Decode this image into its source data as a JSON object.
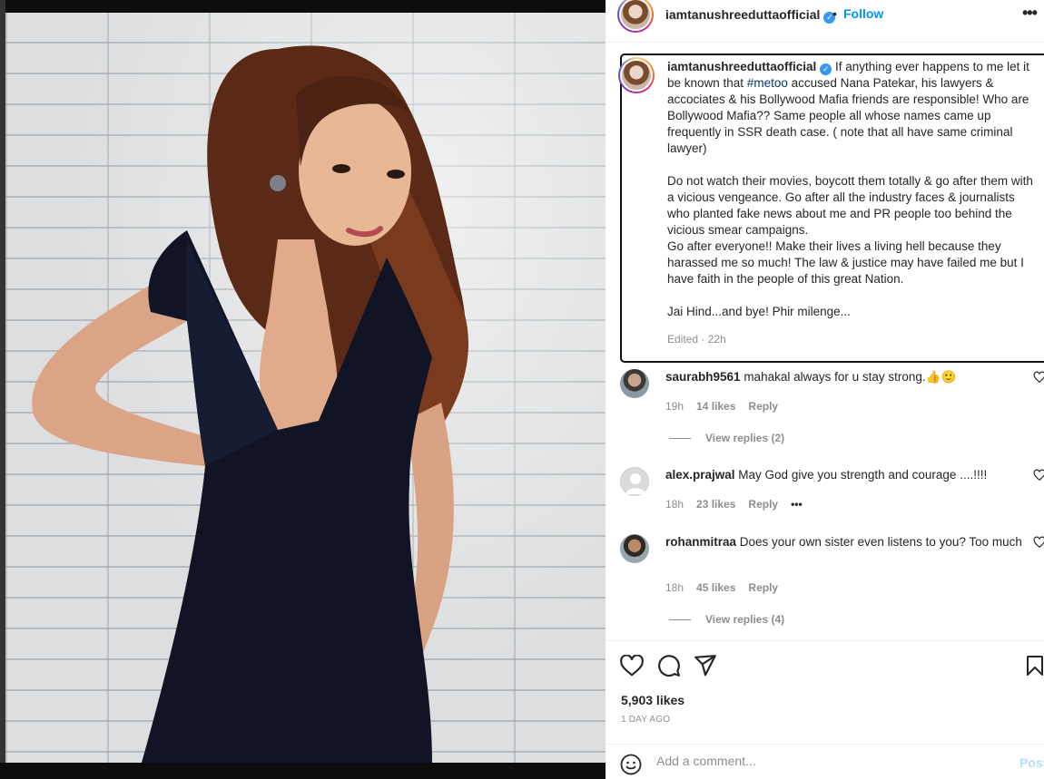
{
  "post": {
    "username": "iamtanushreeduttaofficial",
    "follow_label": "Follow",
    "dot": "•",
    "more_label": "•••"
  },
  "caption": {
    "username": "iamtanushreeduttaofficial",
    "text_before_tag": " If anything ever happens to me let it be known that ",
    "hashtag": "#metoo",
    "text_after_tag": " accused Nana Patekar, his lawyers & accociates & his Bollywood Mafia friends are responsible! Who are Bollywood Mafia?? Same people all whose names came up frequently in SSR death case. ( note that all have same criminal lawyer)\n\nDo not watch their movies, boycott them totally & go after them with a vicious vengeance. Go after all the industry faces & journalists who planted fake news about me and PR people too behind the vicious smear campaigns.\nGo after everyone!! Make their lives a living hell because they harassed me so much! The law & justice may have failed me but I have faith in the people of this great Nation.\n\nJai Hind...and bye! Phir milenge...",
    "edited": "Edited · 22h"
  },
  "comments": [
    {
      "username": "saurabh9561",
      "text": " mahakal always for u stay strong.👍🙂",
      "time": "19h",
      "likes": "14 likes",
      "reply": "Reply",
      "view_replies": "View replies (2)"
    },
    {
      "username": "alex.prajwal",
      "text": " May God give you strength and courage ....!!!!",
      "time": "18h",
      "likes": "23 likes",
      "reply": "Reply",
      "more": "•••"
    },
    {
      "username": "rohanmitraa",
      "text": " Does your own sister even listens to you? Too much",
      "time": "18h",
      "likes": "45 likes",
      "reply": "Reply",
      "view_replies": "View replies (4)"
    }
  ],
  "footer": {
    "likes": "5,903 likes",
    "date": "1 DAY AGO",
    "comment_placeholder": "Add a comment...",
    "post_label": "Post"
  },
  "colors": {
    "link": "#0095f6",
    "verified": "#3897f0",
    "muted": "#8e8e8e"
  },
  "icons": [
    "verified-icon",
    "heart-icon",
    "comment-icon",
    "share-icon",
    "bookmark-icon",
    "emoji-icon",
    "more-icon"
  ]
}
